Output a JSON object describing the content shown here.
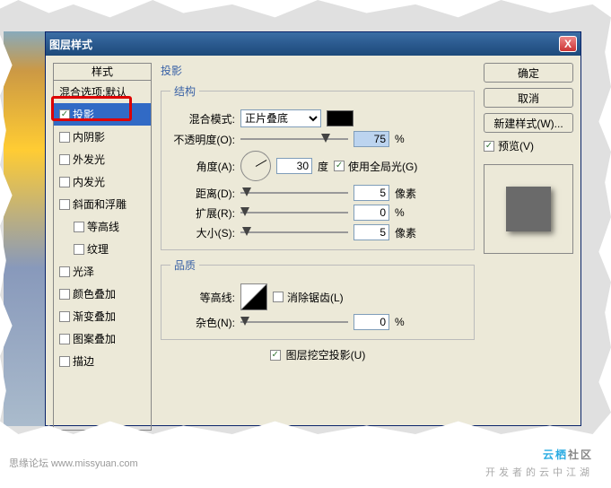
{
  "dialog": {
    "title": "图层样式",
    "styles_header": "样式",
    "styles": [
      {
        "label": "混合选项:默认",
        "checked": null,
        "selected": false,
        "indent": false
      },
      {
        "label": "投影",
        "checked": true,
        "selected": true,
        "indent": false
      },
      {
        "label": "内阴影",
        "checked": false,
        "selected": false,
        "indent": false
      },
      {
        "label": "外发光",
        "checked": false,
        "selected": false,
        "indent": false
      },
      {
        "label": "内发光",
        "checked": false,
        "selected": false,
        "indent": false
      },
      {
        "label": "斜面和浮雕",
        "checked": false,
        "selected": false,
        "indent": false
      },
      {
        "label": "等高线",
        "checked": false,
        "selected": false,
        "indent": true
      },
      {
        "label": "纹理",
        "checked": false,
        "selected": false,
        "indent": true
      },
      {
        "label": "光泽",
        "checked": false,
        "selected": false,
        "indent": false
      },
      {
        "label": "颜色叠加",
        "checked": false,
        "selected": false,
        "indent": false
      },
      {
        "label": "渐变叠加",
        "checked": false,
        "selected": false,
        "indent": false
      },
      {
        "label": "图案叠加",
        "checked": false,
        "selected": false,
        "indent": false
      },
      {
        "label": "描边",
        "checked": false,
        "selected": false,
        "indent": false
      }
    ]
  },
  "panel": {
    "title": "投影",
    "structure": {
      "legend": "结构",
      "blend_label": "混合模式:",
      "blend_value": "正片叠底",
      "opacity_label": "不透明度(O):",
      "opacity_value": "75",
      "opacity_unit": "%",
      "angle_label": "角度(A):",
      "angle_value": "30",
      "angle_unit": "度",
      "global_light_label": "使用全局光(G)",
      "global_light_checked": true,
      "distance_label": "距离(D):",
      "distance_value": "5",
      "distance_unit": "像素",
      "spread_label": "扩展(R):",
      "spread_value": "0",
      "spread_unit": "%",
      "size_label": "大小(S):",
      "size_value": "5",
      "size_unit": "像素"
    },
    "quality": {
      "legend": "品质",
      "contour_label": "等高线:",
      "antialias_label": "消除锯齿(L)",
      "antialias_checked": false,
      "noise_label": "杂色(N):",
      "noise_value": "0",
      "noise_unit": "%"
    },
    "knockout_label": "图层挖空投影(U)",
    "knockout_checked": true
  },
  "buttons": {
    "ok": "确定",
    "cancel": "取消",
    "new_style": "新建样式(W)...",
    "preview_label": "预览(V)",
    "preview_checked": true
  },
  "footer": {
    "credit": "思缘论坛   www.missyuan.com"
  },
  "logo": {
    "text1": "云栖",
    "text2": "社区",
    "tagline": "开发者的云中江湖"
  }
}
